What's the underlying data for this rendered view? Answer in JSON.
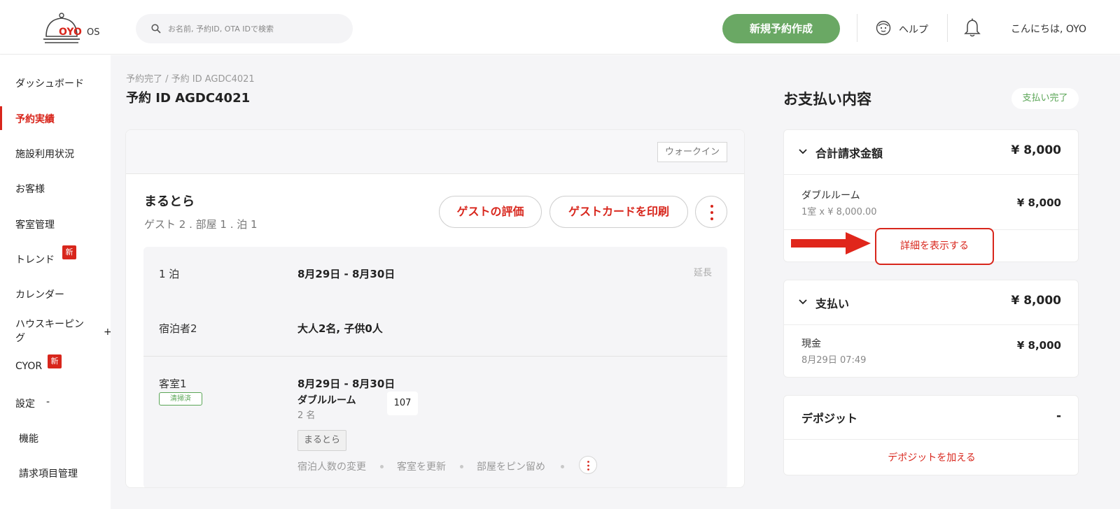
{
  "header": {
    "logo_text": "OYO",
    "logo_suffix": "OS",
    "search_placeholder": "お名前, 予約ID, OTA IDで検索",
    "new_booking_label": "新規予約作成",
    "help_label": "ヘルプ",
    "greeting": "こんにちは, OYO"
  },
  "sidebar": {
    "items": [
      {
        "label": "ダッシュボード"
      },
      {
        "label": "予約実績"
      },
      {
        "label": "施設利用状況"
      },
      {
        "label": "お客様"
      },
      {
        "label": "客室管理"
      },
      {
        "label": "トレンド",
        "badge": "新"
      },
      {
        "label": "カレンダー"
      },
      {
        "label": "ハウスキーピング",
        "line1": "ハウスキーピン",
        "line2": "グ",
        "toggle": "+"
      },
      {
        "label": "CYOR",
        "badge": "新"
      },
      {
        "label": "設定",
        "toggle": "-"
      },
      {
        "label": "機能"
      },
      {
        "label": "請求項目管理"
      }
    ]
  },
  "breadcrumb": "予約完了 / 予約 ID AGDC4021",
  "page_title": "予約 ID AGDC4021",
  "booking": {
    "source_tag": "ウォークイン",
    "guest_name": "まるとら",
    "guest_meta": "ゲスト 2 . 部屋 1 . 泊 1",
    "rate_guest_label": "ゲストの評価",
    "print_card_label": "ゲストカードを印刷",
    "nights_label": "1 泊",
    "nights_dates": "8月29日 - 8月30日",
    "extend_label": "延長",
    "occupants_label": "宿泊者2",
    "occupants_value": "大人2名, 子供0人",
    "room_label": "客室1",
    "room_status": "清掃済",
    "room_dates": "8月29日 - 8月30日",
    "room_type": "ダブルルーム",
    "room_guests": "2 名",
    "room_number": "107",
    "room_guest_tag": "まるとら",
    "actions": [
      "宿泊人数の変更",
      "客室を更新",
      "部屋をピン留め"
    ]
  },
  "payment": {
    "title": "お支払い内容",
    "status": "支払い完了",
    "total_label": "合計請求金額",
    "total_amount": "¥ 8,000",
    "line_item_label": "ダブルルーム",
    "line_item_meta": "1室 x ¥ 8,000.00",
    "line_item_amount": "¥ 8,000",
    "show_detail_label": "詳細を表示する",
    "paid_label": "支払い",
    "paid_amount": "¥ 8,000",
    "method_label": "現金",
    "method_time": "8月29日 07:49",
    "method_amount": "¥ 8,000",
    "deposit_label": "デポジット",
    "deposit_amount": "-",
    "add_deposit_label": "デポジットを加える"
  },
  "colors": {
    "brand_red": "#d8261c",
    "accent_green": "#6aa864",
    "status_green": "#5aa556"
  }
}
